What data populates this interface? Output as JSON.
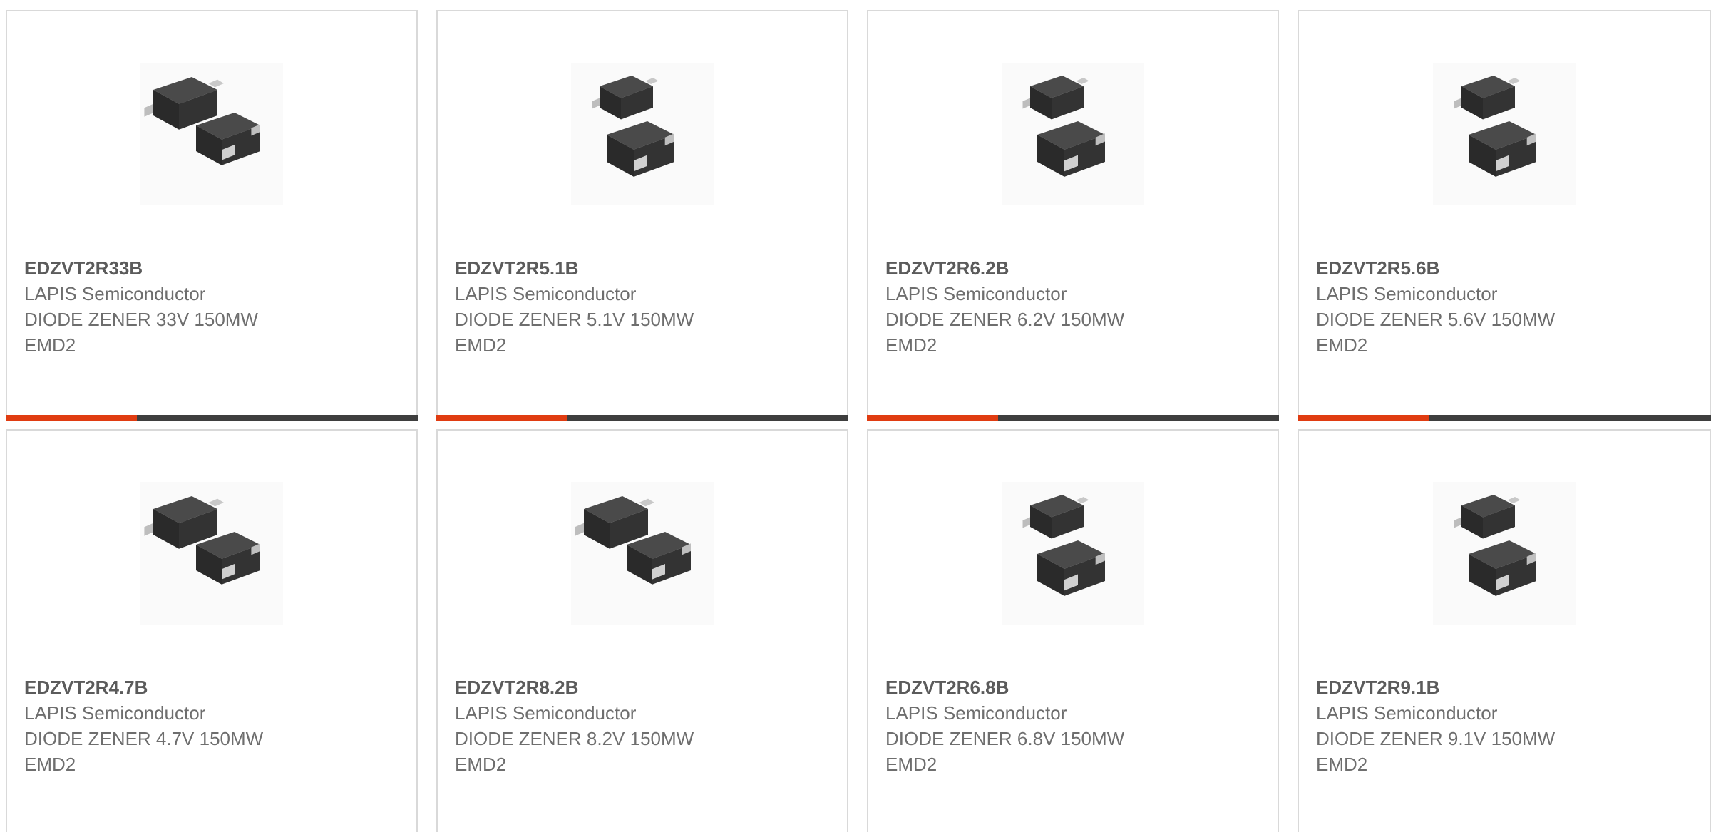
{
  "colors": {
    "accent": "#e03c11",
    "bar": "#3e3e3e",
    "border": "#d9d9d9"
  },
  "products": [
    {
      "part": "EDZVT2R33B",
      "maker": "LAPIS Semiconductor",
      "desc": "DIODE ZENER 33V 150MW",
      "pkg": "EMD2",
      "image": "diode-pair-side-icon"
    },
    {
      "part": "EDZVT2R5.1B",
      "maker": "LAPIS Semiconductor",
      "desc": "DIODE ZENER 5.1V 150MW",
      "pkg": "EMD2",
      "image": "diode-pair-stacked-icon"
    },
    {
      "part": "EDZVT2R6.2B",
      "maker": "LAPIS Semiconductor",
      "desc": "DIODE ZENER 6.2V 150MW",
      "pkg": "EMD2",
      "image": "diode-pair-stacked-icon"
    },
    {
      "part": "EDZVT2R5.6B",
      "maker": "LAPIS Semiconductor",
      "desc": "DIODE ZENER 5.6V 150MW",
      "pkg": "EMD2",
      "image": "diode-pair-stacked-icon"
    },
    {
      "part": "EDZVT2R4.7B",
      "maker": "LAPIS Semiconductor",
      "desc": "DIODE ZENER 4.7V 150MW",
      "pkg": "EMD2",
      "image": "diode-pair-side-icon"
    },
    {
      "part": "EDZVT2R8.2B",
      "maker": "LAPIS Semiconductor",
      "desc": "DIODE ZENER 8.2V 150MW",
      "pkg": "EMD2",
      "image": "diode-pair-side-icon"
    },
    {
      "part": "EDZVT2R6.8B",
      "maker": "LAPIS Semiconductor",
      "desc": "DIODE ZENER 6.8V 150MW",
      "pkg": "EMD2",
      "image": "diode-pair-stacked-icon"
    },
    {
      "part": "EDZVT2R9.1B",
      "maker": "LAPIS Semiconductor",
      "desc": "DIODE ZENER 9.1V 150MW",
      "pkg": "EMD2",
      "image": "diode-pair-stacked-icon"
    }
  ]
}
